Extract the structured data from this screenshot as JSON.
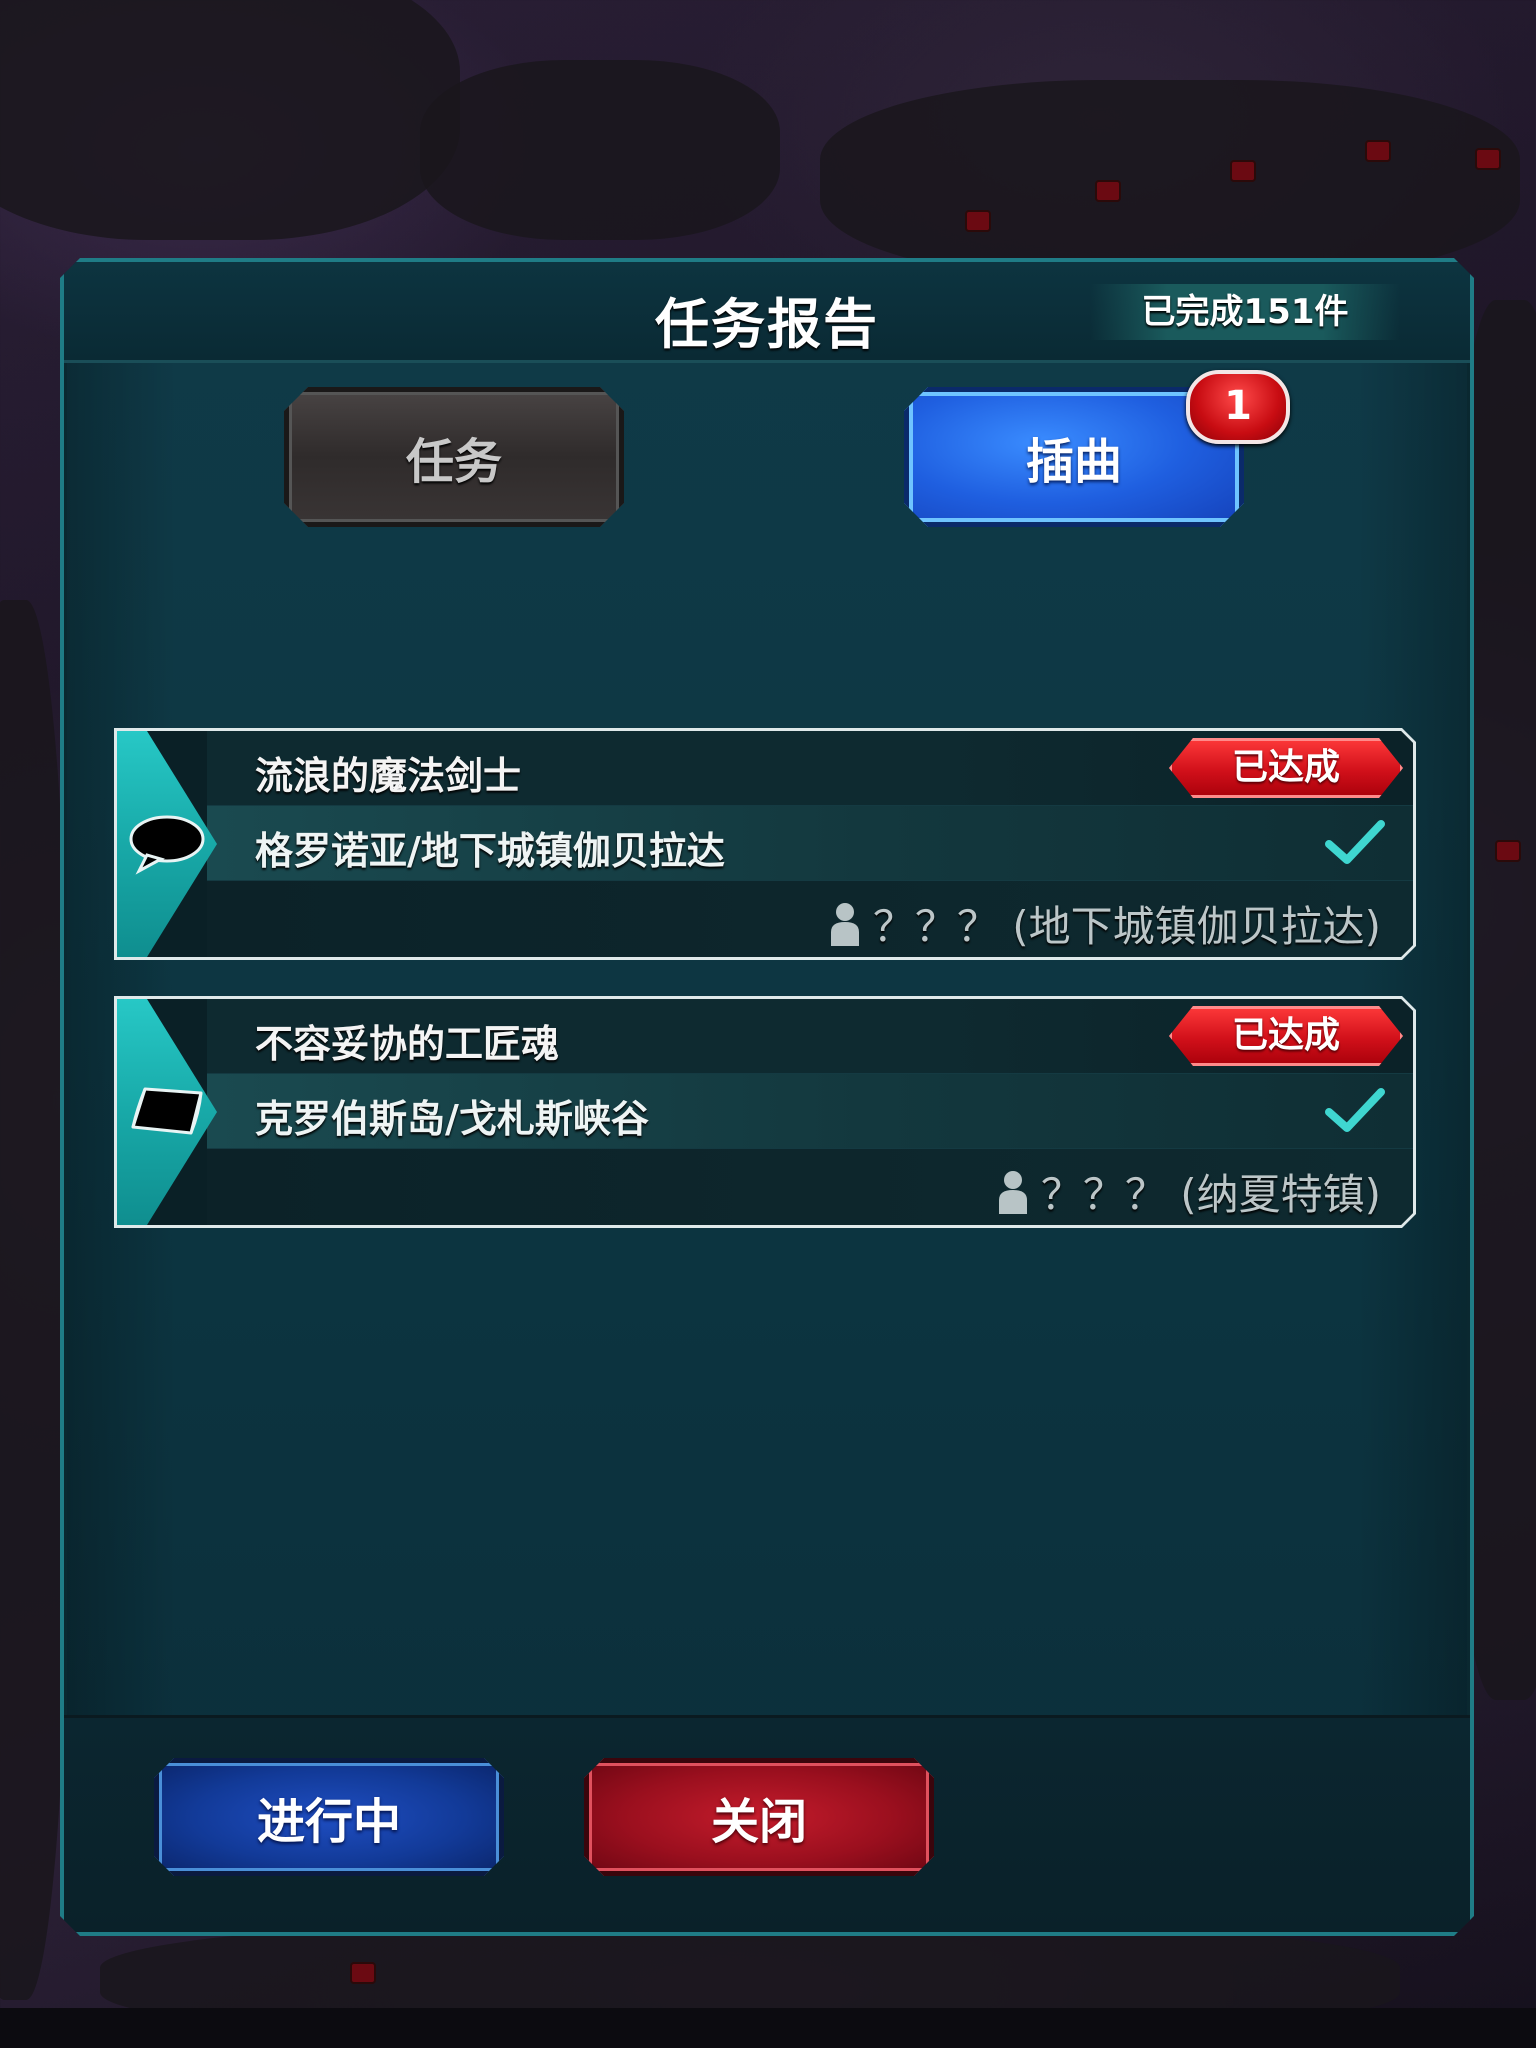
{
  "dialog": {
    "title": "任务报告",
    "completed_count": "已完成151件"
  },
  "tabs": [
    {
      "label": "任务",
      "active": false
    },
    {
      "label": "插曲",
      "active": true,
      "badge": "1"
    }
  ],
  "quests": [
    {
      "title": "流浪的魔法剑士",
      "status": "已达成",
      "location": "格罗诺亚/地下城镇伽贝拉达",
      "npc": "？？？ (地下城镇伽贝拉达)",
      "icon": "speech-bubble-icon",
      "completed": true
    },
    {
      "title": "不容妥协的工匠魂",
      "status": "已达成",
      "location": "克罗伯斯岛/戈札斯峡谷",
      "npc": "？？？ (纳夏特镇)",
      "icon": "map-scroll-icon",
      "completed": true
    }
  ],
  "buttons": {
    "in_progress": "进行中",
    "close": "关闭"
  },
  "colors": {
    "panel_bg": "#0e3844",
    "panel_border": "#2aa0a8",
    "active_tab": "#1f5fe0",
    "badge_red": "#c80c12",
    "status_red": "#d1101a",
    "check_teal": "#3fd6d0",
    "quest_tab_teal": "#18a9a8"
  }
}
